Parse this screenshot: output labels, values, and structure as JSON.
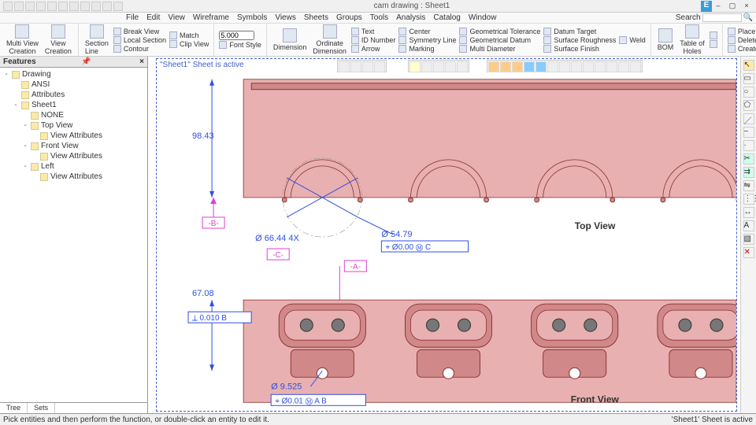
{
  "title": "cam drawing : Sheet1",
  "menu": [
    "File",
    "Edit",
    "View",
    "Wireframe",
    "Symbols",
    "Views",
    "Sheets",
    "Groups",
    "Tools",
    "Analysis",
    "Catalog",
    "Window"
  ],
  "search_label": "Search",
  "ribbon": {
    "multiview": "Multi View\nCreation",
    "view_creation": "View\nCreation",
    "section_line": "Section Line",
    "break_view": "Break View",
    "local_section": "Local Section",
    "contour": "Contour",
    "match": "Match",
    "clip_view": "Clip View",
    "font_size": "5.000",
    "font_style": "Font Style",
    "dimension": "Dimension",
    "ordinate": "Ordinate\nDimension",
    "text": "Text",
    "id_number": "ID Number",
    "arrow": "Arrow",
    "center": "Center",
    "symmetry": "Symmetry Line",
    "marking": "Marking",
    "geom_tol": "Geometrical Tolerance",
    "geom_datum": "Geometrical Datum",
    "multi_diam": "Multi Diameter",
    "datum_target": "Datum Target",
    "surface_rough": "Surface Roughness",
    "surface_finish": "Surface Finish",
    "weld": "Weld",
    "bom": "BOM",
    "table_holes": "Table of\nHoles",
    "place_group": "Place Group",
    "delete_master": "Delete Master Group",
    "create_group": "Create Group"
  },
  "features": {
    "header": "Features",
    "tabs": [
      "Tree",
      "Sets"
    ],
    "tree": [
      {
        "lvl": 0,
        "exp": "-",
        "label": "Drawing"
      },
      {
        "lvl": 1,
        "exp": "",
        "label": "ANSI"
      },
      {
        "lvl": 1,
        "exp": "",
        "label": "Attributes"
      },
      {
        "lvl": 1,
        "exp": "-",
        "label": "Sheet1"
      },
      {
        "lvl": 2,
        "exp": "",
        "label": "NONE"
      },
      {
        "lvl": 2,
        "exp": "-",
        "label": "Top View"
      },
      {
        "lvl": 3,
        "exp": "",
        "label": "View Attributes"
      },
      {
        "lvl": 2,
        "exp": "-",
        "label": "Front View"
      },
      {
        "lvl": 3,
        "exp": "",
        "label": "View Attributes"
      },
      {
        "lvl": 2,
        "exp": "-",
        "label": "Left"
      },
      {
        "lvl": 3,
        "exp": "",
        "label": "View Attributes"
      }
    ]
  },
  "drawing": {
    "sheet_active": "\"Sheet1\" Sheet is active",
    "dim_98_43": "98.43",
    "dim_67_08": "67.08",
    "dim_66_44": "Ø 66.44 4X",
    "dim_54_79": "Ø 54.79",
    "dim_9_525": "Ø 9.525",
    "fcf_0010": "⟂  0.010  B",
    "fcf_0000": "⌖  Ø0.00 Ⓜ  C",
    "fcf_0001": "⌖  Ø0.01 Ⓜ  A  B",
    "datum_a": "-A-",
    "datum_b": "-B-",
    "datum_c": "-C-",
    "top_view": "Top View",
    "front_view": "Front View"
  },
  "status": {
    "prompt": "Pick entities and then perform the function, or double-click an entity to edit it.",
    "right": "'Sheet1' Sheet is active"
  },
  "colors": [
    "#000",
    "#333",
    "#666",
    "#999",
    "#ccc",
    "#fff",
    "#f00",
    "#ff0",
    "#0f0",
    "#0ff",
    "#00f",
    "#f0f",
    "#800",
    "#880",
    "#080",
    "#088"
  ]
}
